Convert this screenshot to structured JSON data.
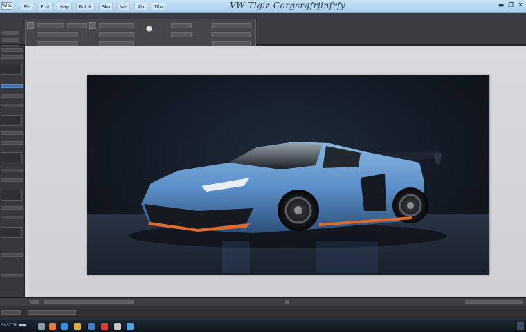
{
  "window": {
    "title": "VW  Tlgiz Corgsrgfrjinfrfy",
    "app_badge": "Wlbu"
  },
  "menu": [
    "Fle",
    "Edit",
    "Hay",
    "Bolok",
    "Sko",
    "Vie",
    "Alx",
    "Dlo"
  ],
  "window_controls": [
    "▬",
    "❐",
    "✕"
  ],
  "taskbar": {
    "start_label": "SVSICH ■■■",
    "icons": [
      {
        "name": "search-icon",
        "color": "#8e9aa6"
      },
      {
        "name": "browser-icon",
        "color": "#e97a2c"
      },
      {
        "name": "edge-icon",
        "color": "#3a8fd6"
      },
      {
        "name": "files-icon",
        "color": "#e3b13a"
      },
      {
        "name": "store-icon",
        "color": "#3f7ec9"
      },
      {
        "name": "media-icon",
        "color": "#d33a3a"
      },
      {
        "name": "camera-icon",
        "color": "#c9c9c9"
      },
      {
        "name": "photos-icon",
        "color": "#4aa3e0"
      }
    ]
  },
  "colors": {
    "car_body": "#5b8fc9",
    "car_accent": "#e06a2a",
    "background": "#141a24",
    "titlebar": "#b8d8f0"
  }
}
